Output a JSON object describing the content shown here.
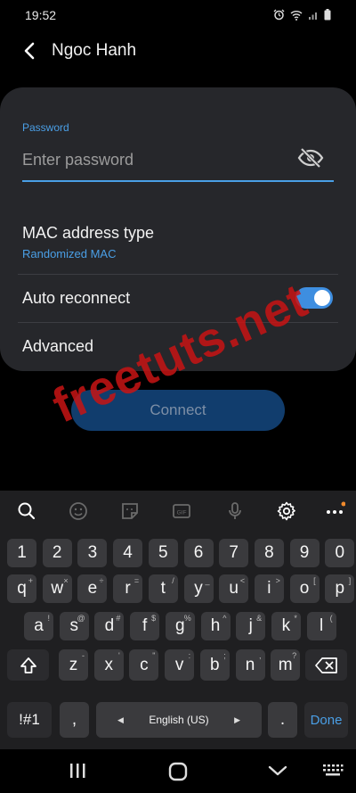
{
  "status": {
    "time": "19:52",
    "icons": [
      "alarm-icon",
      "wifi-icon",
      "signal-icon",
      "battery-icon"
    ]
  },
  "header": {
    "title": "Ngoc Hanh"
  },
  "password": {
    "label": "Password",
    "placeholder": "Enter password",
    "visibility_icon": "eye-off-icon"
  },
  "mac": {
    "title": "MAC address type",
    "value": "Randomized MAC"
  },
  "auto_reconnect": {
    "label": "Auto reconnect",
    "enabled": true
  },
  "advanced": {
    "label": "Advanced"
  },
  "connect": {
    "label": "Connect"
  },
  "watermark": "freetuts.net",
  "keyboard": {
    "toolbar": [
      "search-icon",
      "emoji-icon",
      "sticker-icon",
      "gif-icon",
      "mic-icon",
      "settings-icon",
      "more-icon"
    ],
    "row_numbers": [
      "1",
      "2",
      "3",
      "4",
      "5",
      "6",
      "7",
      "8",
      "9",
      "0"
    ],
    "row1": [
      [
        "q",
        "+"
      ],
      [
        "w",
        "×"
      ],
      [
        "e",
        "÷"
      ],
      [
        "r",
        "="
      ],
      [
        "t",
        "/"
      ],
      [
        "y",
        "_"
      ],
      [
        "u",
        "<"
      ],
      [
        "i",
        ">"
      ],
      [
        "o",
        "["
      ],
      [
        "p",
        "]"
      ]
    ],
    "row2": [
      [
        "a",
        "!"
      ],
      [
        "s",
        "@"
      ],
      [
        "d",
        "#"
      ],
      [
        "f",
        "$"
      ],
      [
        "g",
        "%"
      ],
      [
        "h",
        "^"
      ],
      [
        "j",
        "&"
      ],
      [
        "k",
        "*"
      ],
      [
        "l",
        "("
      ]
    ],
    "row3": [
      [
        "z",
        "-"
      ],
      [
        "x",
        "'"
      ],
      [
        "c",
        "\""
      ],
      [
        "v",
        ":"
      ],
      [
        "b",
        ";"
      ],
      [
        "n",
        ","
      ],
      [
        "m",
        "?"
      ]
    ],
    "symbols_key": "!#1",
    "comma_key": ",",
    "space_label": "English (US)",
    "period_key": ".",
    "done_key": "Done"
  },
  "colors": {
    "accent": "#4a9fe6",
    "card": "#26272b",
    "key": "#3a3a3d"
  }
}
